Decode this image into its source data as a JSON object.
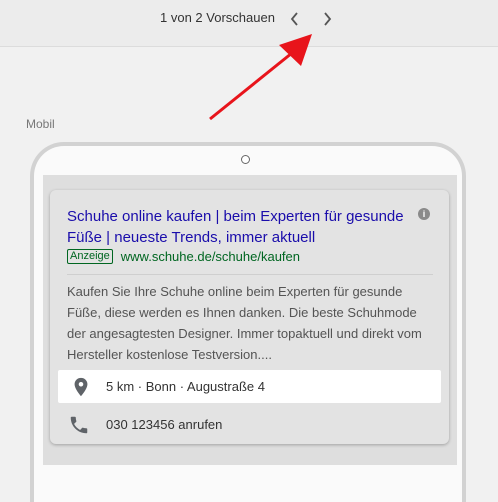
{
  "toolbar": {
    "preview_counter": "1 von 2 Vorschauen",
    "prev_icon": "chevron-left-icon",
    "next_icon": "chevron-right-icon"
  },
  "section": {
    "label": "Mobil"
  },
  "ad": {
    "headline": "Schuhe online kaufen | beim Experten für gesunde Füße | neueste Trends, immer aktuell",
    "badge": "Anzeige",
    "display_url": "www.schuhe.de/schuhe/kaufen",
    "description": "Kaufen Sie Ihre Schuhe online beim Experten für gesunde Füße, diese werden es Ihnen danken. Die beste Schuhmode der angesagtesten Designer. Immer topaktuell und direkt vom Hersteller kostenlose Testversion....",
    "location_text": "5 km · Bonn · Augustraße 4",
    "call_text": "030 123456 anrufen"
  },
  "colors": {
    "headline_link": "#1a0dab",
    "url_green": "#006621",
    "annotation_arrow": "#e8141b"
  }
}
